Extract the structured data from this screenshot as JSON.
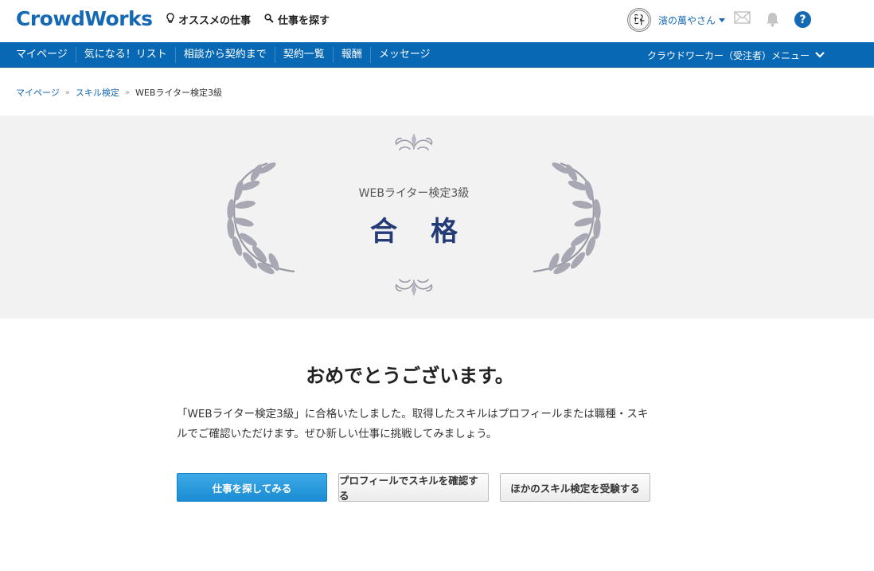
{
  "header": {
    "logo": "CrowdWorks",
    "nav": [
      {
        "label": "オススメの仕事",
        "icon": "lightbulb-icon"
      },
      {
        "label": "仕事を探す",
        "icon": "search-icon"
      }
    ],
    "user": {
      "avatar_text": "濱の萬や",
      "name": "濱の萬やさん"
    },
    "icons": [
      "mail-icon",
      "bell-icon",
      "help-icon"
    ],
    "help_label": "?"
  },
  "navbar": {
    "links": [
      "マイページ",
      "気になる！リスト",
      "相談から契約まで",
      "契約一覧",
      "報酬",
      "メッセージ"
    ],
    "worker_menu": "クラウドワーカー（受注者）メニュー"
  },
  "breadcrumb": {
    "items": [
      "マイページ",
      "スキル検定"
    ],
    "separator": "»",
    "current": "WEBライター検定3級"
  },
  "banner": {
    "exam_name": "WEBライター検定3級",
    "result": "合格"
  },
  "main": {
    "heading": "おめでとうございます。",
    "message": "「WEBライター検定3級」に合格いたしました。取得したスキルはプロフィールまたは職種・スキルでご確認いただけます。ぜひ新しい仕事に挑戦してみましょう。",
    "buttons": {
      "primary": "仕事を探してみる",
      "profile": "プロフィールでスキルを確認する",
      "other": "ほかのスキル検定を受験する"
    }
  },
  "colors": {
    "brand": "#1569b4",
    "navbar": "#0868b4",
    "pass_text": "#233c78",
    "banner_bg": "#f2f2f2",
    "button_primary": "#2b9ddd"
  }
}
